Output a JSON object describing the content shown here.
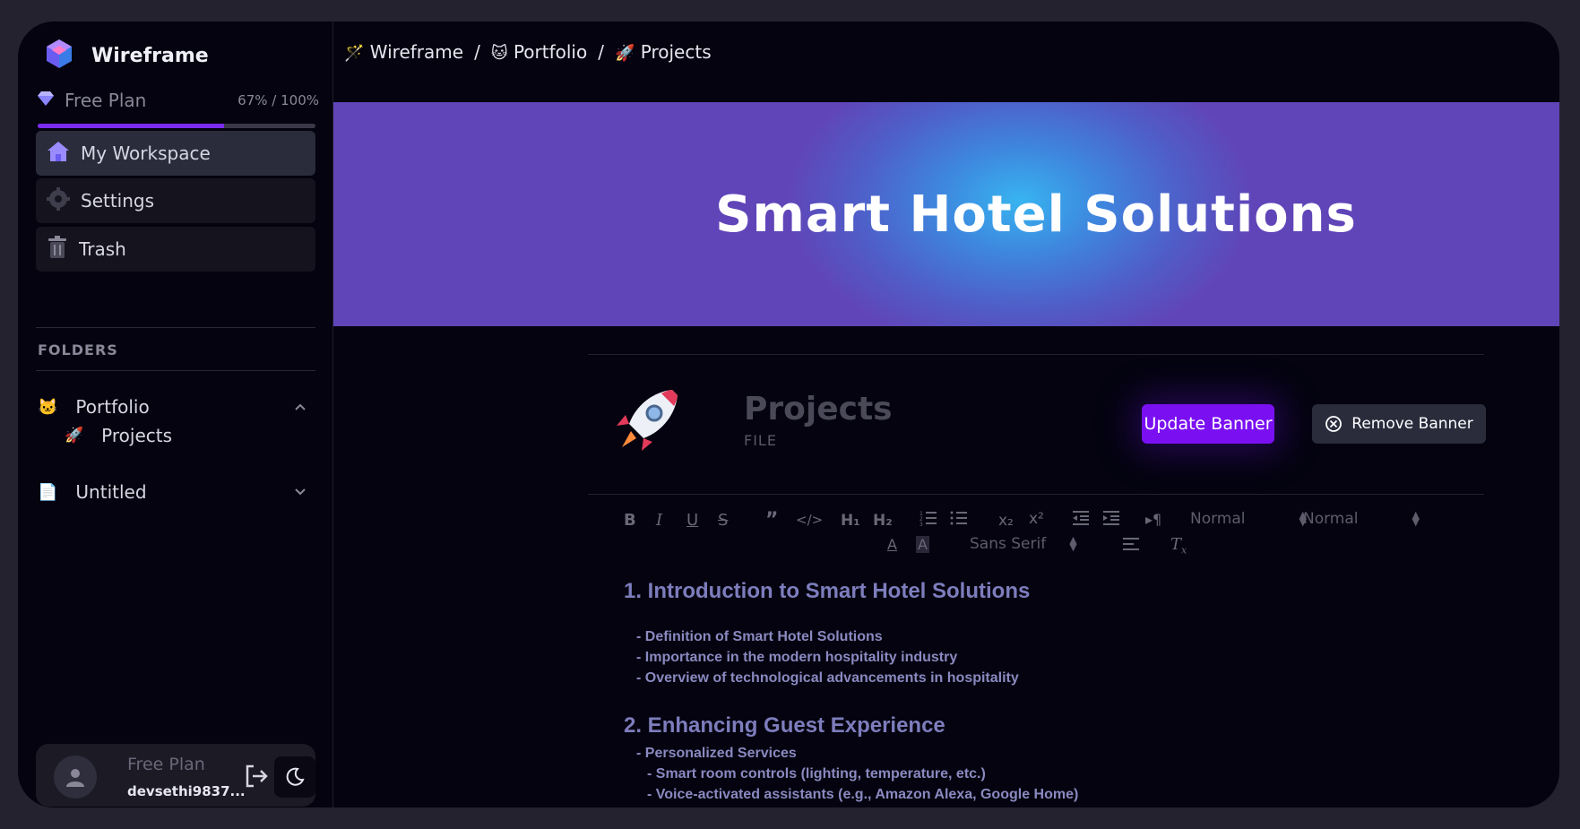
{
  "app": {
    "name": "Wireframe"
  },
  "plan": {
    "label": "Free Plan",
    "usage_text": "67% / 100%",
    "usage_fraction": 0.67
  },
  "nav": [
    {
      "label": "My Workspace",
      "icon": "home-icon",
      "active": true
    },
    {
      "label": "Settings",
      "icon": "gear-icon",
      "active": false
    },
    {
      "label": "Trash",
      "icon": "trash-icon",
      "active": false
    }
  ],
  "folders": {
    "title": "FOLDERS",
    "items": [
      {
        "label": "Portfolio",
        "icon": "🐱",
        "expanded": true,
        "files": [
          {
            "label": "Projects",
            "icon": "🚀"
          }
        ]
      },
      {
        "label": "Untitled",
        "icon": "📄",
        "expanded": false
      }
    ]
  },
  "user": {
    "plan": "Free Plan",
    "name": "devsethi9837..."
  },
  "breadcrumb": [
    {
      "label": "Wireframe",
      "icon": "🪄"
    },
    {
      "label": "Portfolio",
      "icon": "🐱"
    },
    {
      "label": "Projects",
      "icon": "🚀"
    }
  ],
  "banner": {
    "title": "Smart Hotel Solutions"
  },
  "document": {
    "icon": "🚀",
    "title": "Projects",
    "subtitle": "FILE",
    "update_banner_label": "Update Banner",
    "remove_banner_label": "Remove Banner"
  },
  "toolbar": {
    "header_select": "Normal",
    "size_select": "Normal",
    "font_select": "Sans Serif"
  },
  "content": {
    "sections": [
      {
        "heading": "1. Introduction to Smart Hotel Solutions",
        "items": [
          "- Definition of Smart Hotel Solutions",
          "- Importance in the modern hospitality industry",
          "- Overview of technological advancements in hospitality"
        ]
      },
      {
        "heading": "2. Enhancing Guest Experience",
        "items": [
          "- Personalized Services",
          "- Smart room controls (lighting, temperature, etc.)",
          "- Voice-activated assistants (e.g., Amazon Alexa, Google Home)"
        ]
      }
    ]
  },
  "colors": {
    "accent": "#7a10f2",
    "background": "#04030f",
    "sidebar_active": "#2a2c3c"
  }
}
